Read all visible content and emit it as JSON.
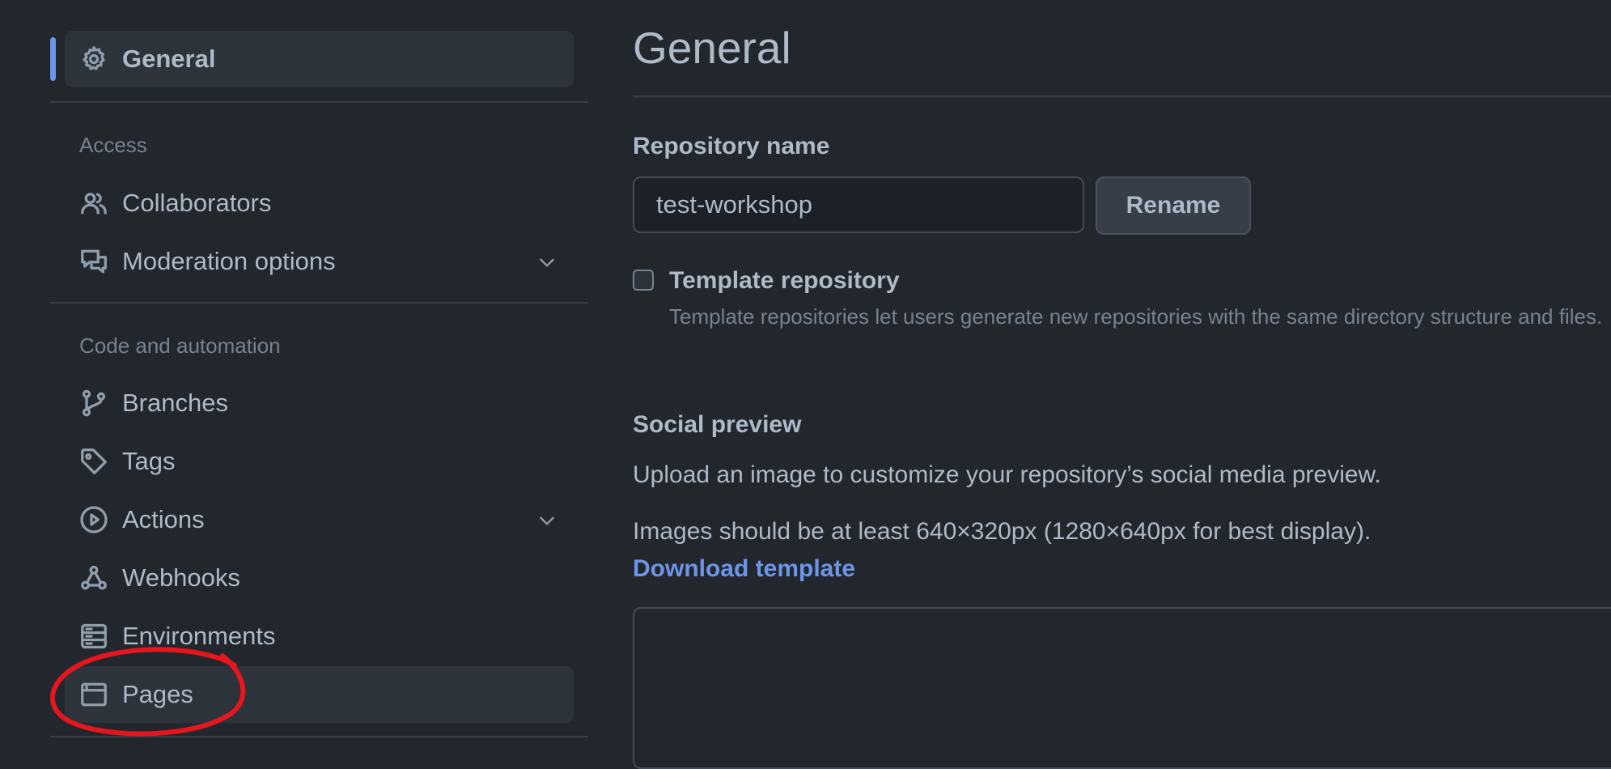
{
  "sidebar": {
    "general": {
      "label": "General",
      "icon": "gear-icon"
    },
    "sections": [
      {
        "title": "Access"
      },
      {
        "title": "Code and automation"
      }
    ],
    "items": [
      {
        "label": "Collaborators",
        "icon": "people-icon"
      },
      {
        "label": "Moderation options",
        "icon": "comment-discussion-icon"
      },
      {
        "label": "Branches",
        "icon": "git-branch-icon"
      },
      {
        "label": "Tags",
        "icon": "tag-icon"
      },
      {
        "label": "Actions",
        "icon": "play-icon"
      },
      {
        "label": "Webhooks",
        "icon": "webhook-icon"
      },
      {
        "label": "Environments",
        "icon": "server-icon"
      },
      {
        "label": "Pages",
        "icon": "browser-icon"
      }
    ]
  },
  "main": {
    "title": "General",
    "repo_name_label": "Repository name",
    "repo_name_value": "test-workshop",
    "rename_label": "Rename",
    "template": {
      "label": "Template repository",
      "checked": false,
      "description": "Template repositories let users generate new repositories with the same directory structure and files."
    },
    "social_preview": {
      "heading": "Social preview",
      "line1": "Upload an image to customize your repository’s social media preview.",
      "line2": "Images should be at least 640×320px (1280×640px for best display).",
      "download_link": "Download template"
    }
  },
  "annotation": {
    "color": "#e5161d",
    "target": "Pages"
  },
  "colors": {
    "background": "#22272e",
    "accent": "#6d95e8",
    "text": "#adbac7",
    "muted": "#768390"
  }
}
